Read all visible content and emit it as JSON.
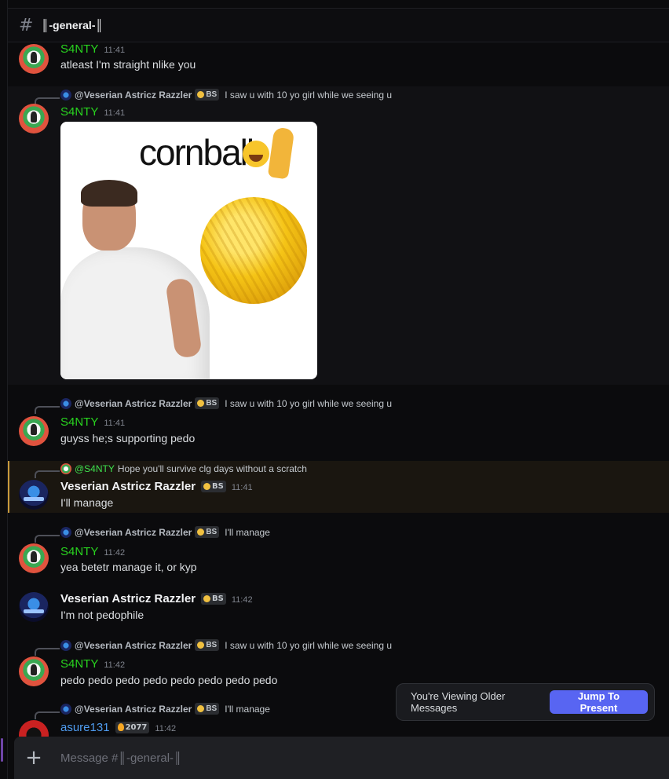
{
  "header": {
    "hash_icon": "#",
    "channel_name": "║-general-║"
  },
  "messages": [
    {
      "author": "S4NTY",
      "time": "11:41",
      "text": "atleast I'm straight nlike you"
    },
    {
      "reply_to": "@Veserian Astricz Razzler",
      "reply_tag": "BS",
      "reply_text": "I saw u with 10 yo girl  while we seeing u",
      "author": "S4NTY",
      "time": "11:41",
      "attachment": {
        "caption_word": "cornball"
      }
    },
    {
      "reply_to": "@Veserian Astricz Razzler",
      "reply_tag": "BS",
      "reply_text": "I saw u with 10 yo girl  while we seeing u",
      "author": "S4NTY",
      "time": "11:41",
      "text": "guyss he;s supporting pedo"
    },
    {
      "reply_to": "@S4NTY",
      "reply_text": "Hope you'll survive clg days without a scratch",
      "author": "Veserian Astricz Razzler",
      "author_tag": "BS",
      "time": "11:41",
      "text": "I'll manage"
    },
    {
      "reply_to": "@Veserian Astricz Razzler",
      "reply_tag": "BS",
      "reply_text": "I'll manage",
      "author": "S4NTY",
      "time": "11:42",
      "text": "yea betetr manage it, or kyp"
    },
    {
      "author": "Veserian Astricz Razzler",
      "author_tag": "BS",
      "time": "11:42",
      "text": "I'm not pedophile"
    },
    {
      "reply_to": "@Veserian Astricz Razzler",
      "reply_tag": "BS",
      "reply_text": "I saw u with 10 yo girl  while we seeing u",
      "author": "S4NTY",
      "time": "11:42",
      "text": "pedo pedo pedo pedo pedo pedo pedo pedo"
    },
    {
      "reply_to": "@Veserian Astricz Razzler",
      "reply_tag": "BS",
      "reply_text": "I'll manage",
      "author": "asure131",
      "author_tag": "2077",
      "time": "11:42"
    }
  ],
  "older_bar": {
    "text": "You're Viewing Older Messages",
    "button": "Jump To Present"
  },
  "composer": {
    "plus_icon": "+",
    "placeholder": "Message #║-general-║"
  },
  "colors": {
    "santy": "#29d41f",
    "asure": "#4f9cf0",
    "blurple": "#5865f2",
    "mention_border": "#c89a3c"
  }
}
